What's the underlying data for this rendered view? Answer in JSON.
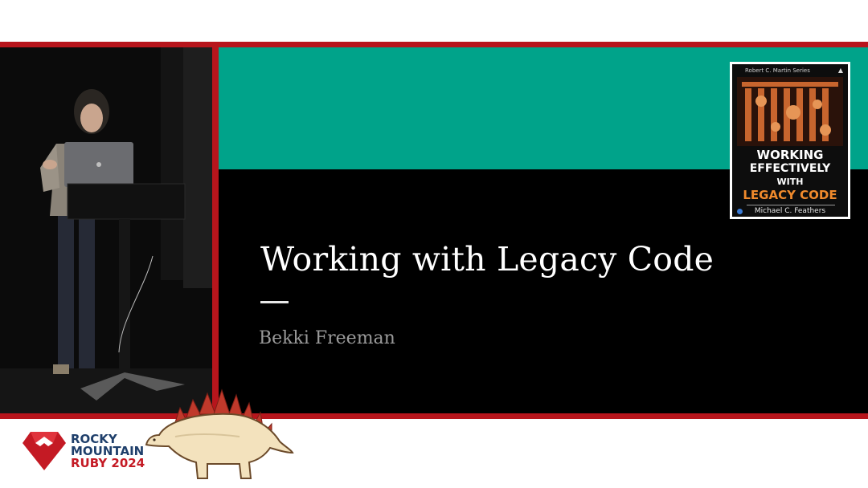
{
  "slide": {
    "title": "Working with Legacy Code",
    "subtitle": "Bekki Freeman"
  },
  "book": {
    "series": "Robert C. Martin Series",
    "title_line1": "WORKING",
    "title_line2": "EFFECTIVELY",
    "title_line3": "WITH",
    "title_line4": "LEGACY CODE",
    "author": "Michael C. Feathers"
  },
  "conference": {
    "line1": "ROCKY",
    "line2": "MOUNTAIN",
    "line3": "RUBY 2024"
  },
  "colors": {
    "frame": "#b7151c",
    "teal": "#00a38a",
    "brand_blue": "#1f3f6b",
    "brand_red": "#c41a24"
  }
}
